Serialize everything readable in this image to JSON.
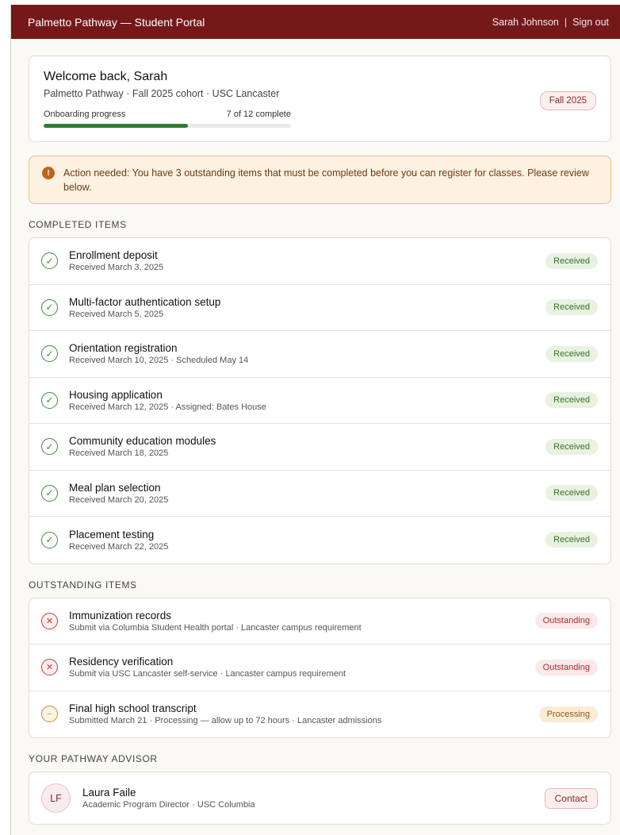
{
  "topbar": {
    "brand": "Palmetto Pathway — Student Portal",
    "user_name": "Sarah Johnson",
    "separator": "|",
    "signout_label": "Sign out"
  },
  "welcome": {
    "heading": "Welcome back, Sarah",
    "subtitle": "Palmetto Pathway · Fall 2025 cohort · USC Lancaster",
    "progress_label": "Onboarding progress",
    "progress_text": "7 of 12 complete",
    "progress_fraction": 0.583,
    "term_badge": "Fall 2025"
  },
  "alert": {
    "icon": "!",
    "text": "Action needed: You have 3 outstanding items that must be completed before you can register for classes. Please review below."
  },
  "completed": {
    "section_title": "COMPLETED ITEMS",
    "items": [
      {
        "title": "Enrollment deposit",
        "meta": "Received March 3, 2025",
        "status": "Received"
      },
      {
        "title": "Multi-factor authentication setup",
        "meta": "Received March 5, 2025",
        "status": "Received"
      },
      {
        "title": "Orientation registration",
        "meta": "Received March 10, 2025 · Scheduled May 14",
        "status": "Received"
      },
      {
        "title": "Housing application",
        "meta": "Received March 12, 2025 · Assigned: Bates House",
        "status": "Received"
      },
      {
        "title": "Community education modules",
        "meta": "Received March 18, 2025",
        "status": "Received"
      },
      {
        "title": "Meal plan selection",
        "meta": "Received March 20, 2025",
        "status": "Received"
      },
      {
        "title": "Placement testing",
        "meta": "Received March 22, 2025",
        "status": "Received"
      }
    ]
  },
  "outstanding": {
    "section_title": "OUTSTANDING ITEMS",
    "items": [
      {
        "title": "Immunization records",
        "meta": "Submit via Columbia Student Health portal · Lancaster campus requirement",
        "status": "Outstanding"
      },
      {
        "title": "Residency verification",
        "meta": "Submit via USC Lancaster self-service · Lancaster campus requirement",
        "status": "Outstanding"
      },
      {
        "title": "Final high school transcript",
        "meta": "Submitted March 21 · Processing — allow up to 72 hours · Lancaster admissions",
        "status": "Processing"
      }
    ]
  },
  "advisor": {
    "section_title": "YOUR PATHWAY ADVISOR",
    "initials": "LF",
    "name": "Laura Faile",
    "role": "Academic Program Director · USC Columbia",
    "contact_label": "Contact"
  },
  "colors": {
    "brand": "#74181a",
    "success": "#2e7d32",
    "warning": "#c0631b",
    "danger": "#c83a3a"
  },
  "icons": {
    "done": "check-circle-icon",
    "fail": "x-circle-icon",
    "pending": "clock-circle-icon",
    "alert": "exclamation-icon"
  }
}
